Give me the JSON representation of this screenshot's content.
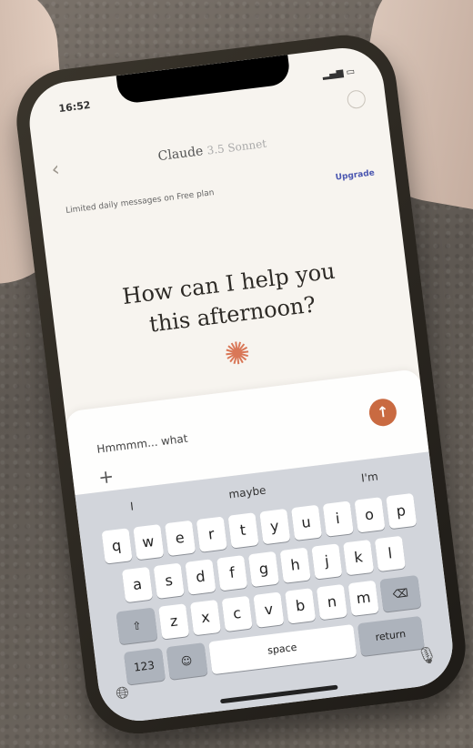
{
  "status": {
    "time": "16:52"
  },
  "header": {
    "model_name": "Claude",
    "model_version": "3.5 Sonnet"
  },
  "banner": {
    "text": "Limited daily messages on Free plan",
    "upgrade_label": "Upgrade"
  },
  "main": {
    "greeting_line1": "How can I help you",
    "greeting_line2": "this afternoon?"
  },
  "composer": {
    "input_value": "Hmmmm... what",
    "send_glyph": "↑",
    "add_glyph": "+"
  },
  "keyboard": {
    "suggestions": [
      "I",
      "maybe",
      "I'm"
    ],
    "row1": [
      "q",
      "w",
      "e",
      "r",
      "t",
      "y",
      "u",
      "i",
      "o",
      "p"
    ],
    "row2": [
      "a",
      "s",
      "d",
      "f",
      "g",
      "h",
      "j",
      "k",
      "l"
    ],
    "row3": [
      "z",
      "x",
      "c",
      "v",
      "b",
      "n",
      "m"
    ],
    "numbers_label": "123",
    "space_label": "space",
    "return_label": "return"
  },
  "colors": {
    "accent": "#c96a41",
    "logo": "#d97757",
    "link": "#4a56b0"
  }
}
